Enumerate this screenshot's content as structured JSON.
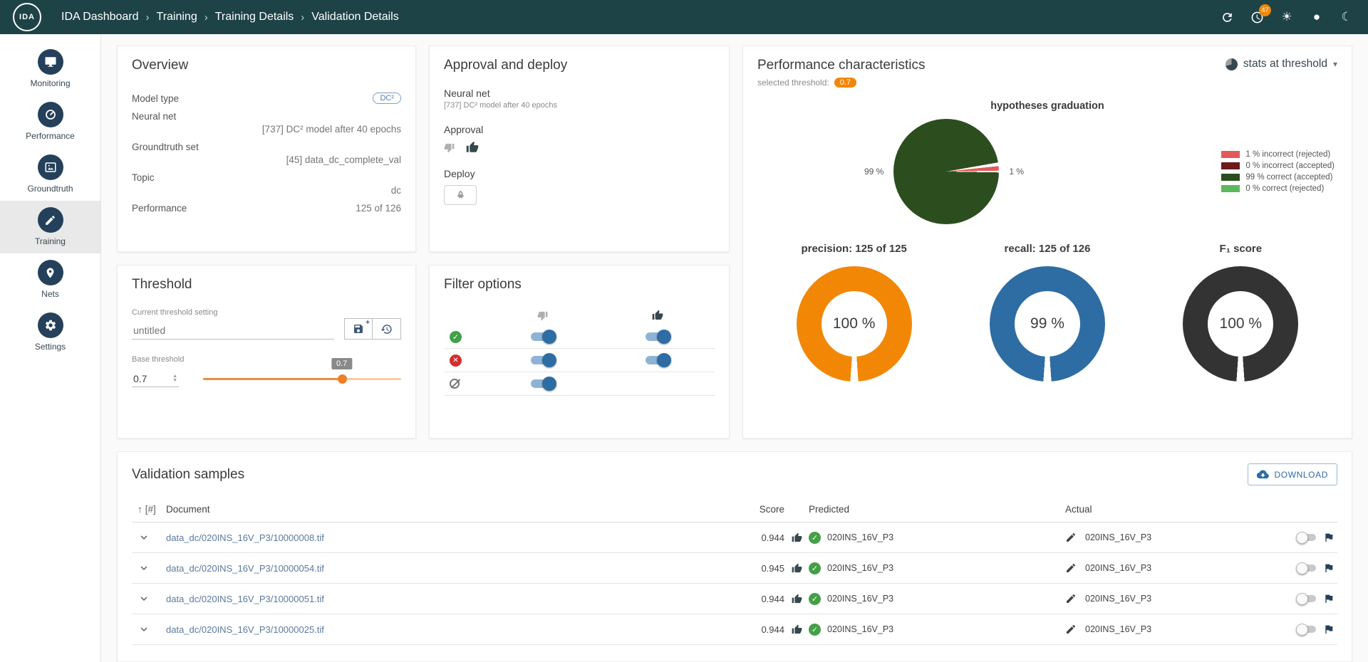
{
  "header": {
    "logo": "IDA",
    "breadcrumbs": [
      "IDA Dashboard",
      "Training",
      "Training Details",
      "Validation Details"
    ],
    "notifications": "47"
  },
  "icons": {
    "chevron_right": "›",
    "sun": "☀",
    "auto_theme": "●",
    "moon": "☾",
    "check": "✓",
    "cross": "✕",
    "sort_asc": "↑",
    "caret_down": "▾",
    "plus": "+"
  },
  "sidebar": {
    "items": [
      {
        "label": "Monitoring"
      },
      {
        "label": "Performance"
      },
      {
        "label": "Groundtruth"
      },
      {
        "label": "Training"
      },
      {
        "label": "Nets"
      },
      {
        "label": "Settings"
      }
    ]
  },
  "overview": {
    "title": "Overview",
    "model_type_label": "Model type",
    "model_type_value": "DC²",
    "neural_net_label": "Neural net",
    "neural_net_value": "[737] DC² model after 40 epochs",
    "groundtruth_label": "Groundtruth set",
    "groundtruth_value": "[45] data_dc_complete_val",
    "topic_label": "Topic",
    "topic_value": "dc",
    "performance_label": "Performance",
    "performance_value": "125 of 126"
  },
  "approval_deploy": {
    "title": "Approval and deploy",
    "neural_net_label": "Neural net",
    "neural_net_value": "[737] DC² model after 40 epochs",
    "approval_label": "Approval",
    "deploy_label": "Deploy"
  },
  "threshold": {
    "title": "Threshold",
    "current_setting_label": "Current threshold setting",
    "name_placeholder": "untitled",
    "base_label": "Base threshold",
    "base_value": "0.7",
    "slider_tooltip": "0.7",
    "slider_percent": 70
  },
  "filter_options": {
    "title": "Filter options"
  },
  "performance_chars": {
    "title": "Performance characteristics",
    "selected_threshold_label": "selected threshold:",
    "selected_threshold_value": "0.7",
    "stats_selector": "stats at threshold",
    "graduation_title": "hypotheses graduation",
    "pie_label_left": "99 %",
    "pie_label_right": "1 %",
    "legend": [
      "1 % incorrect (rejected)",
      "0 % incorrect (accepted)",
      "99 % correct (accepted)",
      "0 % correct (rejected)"
    ],
    "donuts": [
      {
        "title": "precision: 125 of 125",
        "value": "100 %"
      },
      {
        "title": "recall: 125 of 126",
        "value": "99 %"
      },
      {
        "title": "F₁ score",
        "value": "100 %"
      }
    ]
  },
  "validation_samples": {
    "title": "Validation samples",
    "download": "DOWNLOAD",
    "columns": {
      "index": "[#]",
      "document": "Document",
      "score": "Score",
      "predicted": "Predicted",
      "actual": "Actual"
    },
    "rows": [
      {
        "document": "data_dc/020INS_16V_P3/10000008.tif",
        "score": "0.944",
        "predicted": "020INS_16V_P3",
        "actual": "020INS_16V_P3"
      },
      {
        "document": "data_dc/020INS_16V_P3/10000054.tif",
        "score": "0.945",
        "predicted": "020INS_16V_P3",
        "actual": "020INS_16V_P3"
      },
      {
        "document": "data_dc/020INS_16V_P3/10000051.tif",
        "score": "0.944",
        "predicted": "020INS_16V_P3",
        "actual": "020INS_16V_P3"
      },
      {
        "document": "data_dc/020INS_16V_P3/10000025.tif",
        "score": "0.944",
        "predicted": "020INS_16V_P3",
        "actual": "020INS_16V_P3"
      }
    ]
  },
  "colors": {
    "header_bg": "#1e4347",
    "accent_orange": "#f28705",
    "donut_orange": "#f28705",
    "donut_blue": "#2d6da3",
    "donut_dark": "#333333",
    "pie_green": "#2c4e1e",
    "legend_red": "#e15b5b",
    "legend_maroon": "#6d1a1a",
    "legend_light_green": "#5cb85c",
    "toggle_blue": "#2e6da4",
    "link_blue": "#5b7a9d",
    "check_green": "#43a047",
    "cross_red": "#d32f2f"
  },
  "chart_data": [
    {
      "type": "pie",
      "title": "hypotheses graduation",
      "labels": [
        "incorrect (rejected)",
        "incorrect (accepted)",
        "correct (accepted)",
        "correct (rejected)"
      ],
      "values": [
        1,
        0,
        99,
        0
      ],
      "colors": [
        "#e15b5b",
        "#6d1a1a",
        "#2c4e1e",
        "#5cb85c"
      ],
      "annotations": [
        "99 %",
        "1 %"
      ],
      "legend_position": "right"
    },
    {
      "type": "pie",
      "subtype": "donut",
      "title": "precision: 125 of 125",
      "values": [
        100
      ],
      "center_label": "100 %",
      "color": "#f28705"
    },
    {
      "type": "pie",
      "subtype": "donut",
      "title": "recall: 125 of 126",
      "values": [
        99
      ],
      "center_label": "99 %",
      "color": "#2d6da3"
    },
    {
      "type": "pie",
      "subtype": "donut",
      "title": "F₁ score",
      "values": [
        100
      ],
      "center_label": "100 %",
      "color": "#333333"
    }
  ]
}
